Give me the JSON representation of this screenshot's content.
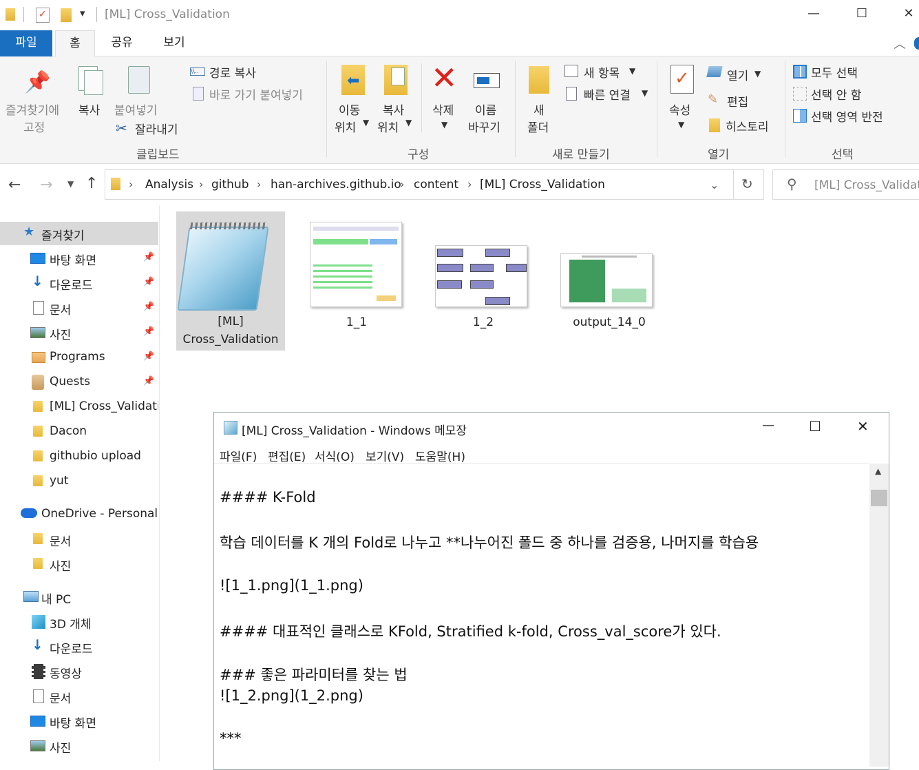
{
  "titlebar": {
    "title": "[ML] Cross_Validation"
  },
  "tabs": [
    "파일",
    "홈",
    "공유",
    "보기"
  ],
  "ribbon": {
    "pin_label1": "즐겨찾기에",
    "pin_label2": "고정",
    "copy": "복사",
    "paste": "붙여넣기",
    "copy_path": "경로 복사",
    "paste_shortcut": "바로 가기 붙여넣기",
    "cut": "잘라내기",
    "clipboard_group": "클립보드",
    "move1": "이동",
    "move2": "위치",
    "copyto1": "복사",
    "copyto2": "위치",
    "delete": "삭제",
    "rename1": "이름",
    "rename2": "바꾸기",
    "organize_group": "구성",
    "newfolder1": "새",
    "newfolder2": "폴더",
    "new_item": "새 항목",
    "easy_access": "빠른 연결",
    "new_group": "새로 만들기",
    "properties": "속성",
    "open": "열기",
    "edit": "편집",
    "history": "히스토리",
    "open_group": "열기",
    "select_all": "모두 선택",
    "select_none": "선택 안 함",
    "invert_selection": "선택 영역 반전",
    "select_group": "선택"
  },
  "address": {
    "crumbs": [
      "Analysis",
      "github",
      "han-archives.github.io",
      "content",
      "[ML] Cross_Validation"
    ],
    "search_placeholder": "[ML] Cross_Validat..."
  },
  "nav": {
    "quick_access": "즐겨찾기",
    "quick_items": [
      "바탕 화면",
      "다운로드",
      "문서",
      "사진",
      "Programs",
      "Quests",
      "[ML] Cross_Validatio",
      "Dacon",
      "githubio upload",
      "yut"
    ],
    "onedrive": "OneDrive - Personal",
    "onedrive_items": [
      "문서",
      "사진"
    ],
    "thispc": "내 PC",
    "pc_items": [
      "3D 개체",
      "다운로드",
      "동영상",
      "문서",
      "바탕 화면",
      "사진"
    ]
  },
  "files": [
    {
      "name1": "[ML]",
      "name2": "Cross_Validation",
      "kind": "notepad-icon"
    },
    {
      "name1": "1_1",
      "kind": "diagram-thumb"
    },
    {
      "name1": "1_2",
      "kind": "flowchart-thumb"
    },
    {
      "name1": "output_14_0",
      "kind": "barchart-thumb"
    }
  ],
  "notepad": {
    "title": "[ML] Cross_Validation - Windows 메모장",
    "menu": [
      "파일(F)",
      "편집(E)",
      "서식(O)",
      "보기(V)",
      "도움말(H)"
    ],
    "lines": [
      "#### K-Fold",
      "학습 데이터를 K 개의 Fold로 나누고 **나누어진 폴드 중 하나를 검증용, 나머지를 학습용",
      "![1_1.png](1_1.png)",
      "#### 대표적인 클래스로 KFold, Stratified k-fold, Cross_val_score가 있다.",
      "### 좋은 파라미터를 찾는 법",
      "![1_2.png](1_2.png)",
      "***"
    ]
  },
  "colors": {
    "accent": "#1a6fc0",
    "selection": "#d9d9d9",
    "nav_selected": "#cce4f7"
  }
}
